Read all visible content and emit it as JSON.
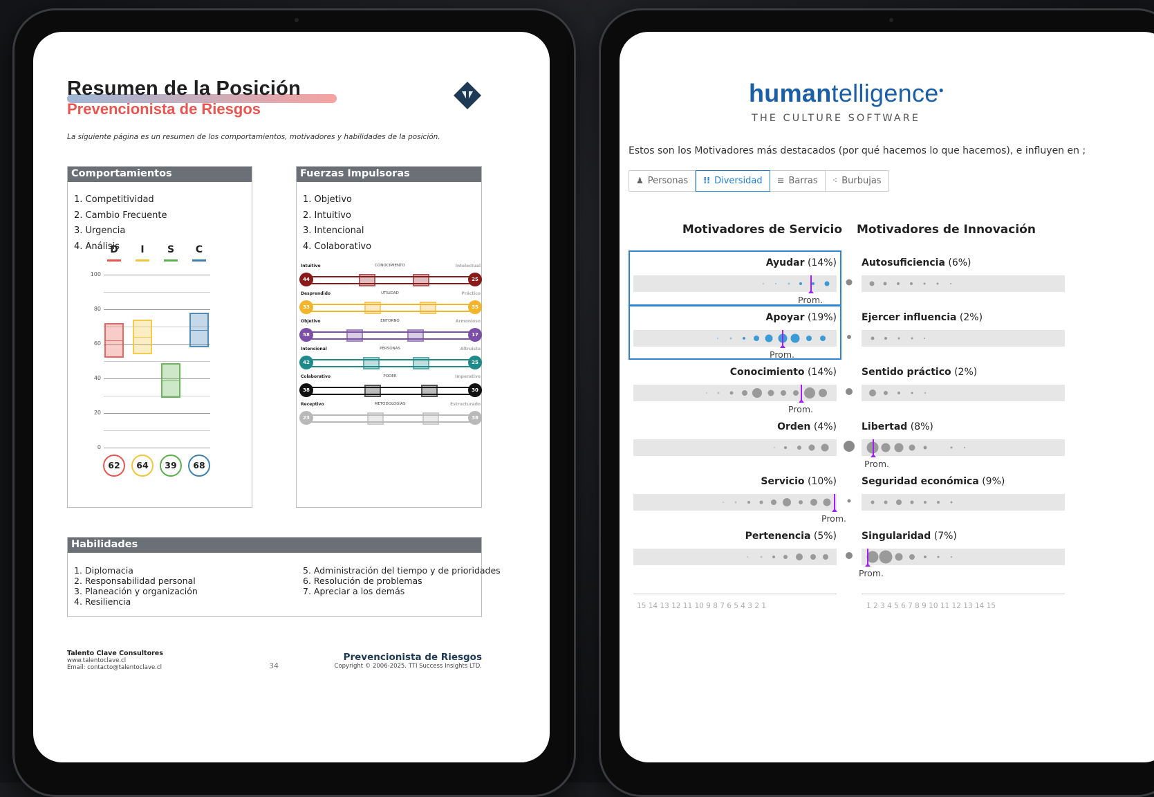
{
  "doc": {
    "title": "Resumen de la Posición",
    "subtitle": "Prevencionista de Riesgos",
    "intro": "La siguiente página es un resumen de los comportamientos, motivadores y habilidades de la posición.",
    "behaviors": {
      "heading": "Comportamientos",
      "items": [
        "1. Competitividad",
        "2. Cambio Frecuente",
        "3. Urgencia",
        "4. Análisis"
      ]
    },
    "disc_chart": {
      "type": "bar",
      "categories": [
        "D",
        "I",
        "S",
        "C"
      ],
      "colors": [
        "#e8564f",
        "#f2c63b",
        "#5ab04c",
        "#3f7fb0"
      ],
      "values": [
        62,
        64,
        39,
        68
      ],
      "ranges": [
        [
          52,
          72
        ],
        [
          54,
          74
        ],
        [
          29,
          49
        ],
        [
          58,
          78
        ]
      ],
      "yticks": [
        "100",
        "80",
        "60",
        "40",
        "20",
        "0"
      ],
      "ylim": [
        0,
        100
      ]
    },
    "drivers": {
      "heading": "Fuerzas Impulsoras",
      "items": [
        "1. Objetivo",
        "2. Intuitivo",
        "3. Intencional",
        "4. Colaborativo"
      ],
      "rows": [
        {
          "left": "Intuitivo",
          "center": "CONOCIMIENTO",
          "right": "Intelectual",
          "lval": "44",
          "rval": "25",
          "color": "#8b1a1a"
        },
        {
          "left": "Desprendido",
          "center": "UTILIDAD",
          "right": "Práctico",
          "lval": "33",
          "rval": "35",
          "color": "#f2b52b"
        },
        {
          "left": "Objetivo",
          "center": "ENTORNO",
          "right": "Armonioso",
          "lval": "58",
          "rval": "17",
          "color": "#7b4fa8"
        },
        {
          "left": "Intencional",
          "center": "PERSONAS",
          "right": "Altruista",
          "lval": "42",
          "rval": "25",
          "color": "#1e8a8a"
        },
        {
          "left": "Colaborativo",
          "center": "PODER",
          "right": "Imperativo",
          "lval": "38",
          "rval": "30",
          "color": "#111111"
        },
        {
          "left": "Receptivo",
          "center": "METODOLOGÍAS",
          "right": "Estructurado",
          "lval": "23",
          "rval": "38",
          "color": "#b9b9b9"
        }
      ]
    },
    "skills": {
      "heading": "Habilidades",
      "col1": [
        "1. Diplomacia",
        "2. Responsabilidad personal",
        "3. Planeación y organización",
        "4. Resiliencia"
      ],
      "col2": [
        "5. Administración del tiempo y de prioridades",
        "6. Resolución de problemas",
        "7. Apreciar a los demás"
      ]
    },
    "footer": {
      "company": "Talento Clave Consultores",
      "web": "www.talentoclave.cl",
      "email": "Email: contacto@talentoclave.cl",
      "page": "34",
      "position": "Prevencionista de Riesgos",
      "copyright": "Copyright © 2006-2025. TTI Success Insights LTD."
    }
  },
  "app": {
    "brand_bold": "human",
    "brand_rest": "telligence",
    "tagline": "THE CULTURE SOFTWARE",
    "lead": "Estos son los Motivadores más destacados (por qué hacemos lo que hacemos), e influyen en ;",
    "tabs": [
      "Personas",
      "Diversidad",
      "Barras",
      "Burbujas"
    ],
    "active_tab": "Diversidad",
    "col_left": "Motivadores de Servicio",
    "col_right": "Motivadores de Innovación",
    "prom_label": "Prom.",
    "rows": [
      {
        "left": "Ayudar",
        "lpct": "(14%)",
        "right": "Autosuficiencia",
        "rpct": "(6%)"
      },
      {
        "left": "Apoyar",
        "lpct": "(19%)",
        "right": "Ejercer influencia",
        "rpct": "(2%)"
      },
      {
        "left": "Conocimiento",
        "lpct": "(14%)",
        "right": "Sentido práctico",
        "rpct": "(2%)"
      },
      {
        "left": "Orden",
        "lpct": "(4%)",
        "right": "Libertad",
        "rpct": "(8%)"
      },
      {
        "left": "Servicio",
        "lpct": "(10%)",
        "right": "Seguridad económica",
        "rpct": "(9%)"
      },
      {
        "left": "Pertenencia",
        "lpct": "(5%)",
        "right": "Singularidad",
        "rpct": "(7%)"
      }
    ],
    "axis_left": "15 14 13 12 11 10 9 8 7 6 5 4 3 2 1",
    "axis_right": "1 2 3 4 5 6 7 8 9 10 11 12 13 14 15"
  }
}
